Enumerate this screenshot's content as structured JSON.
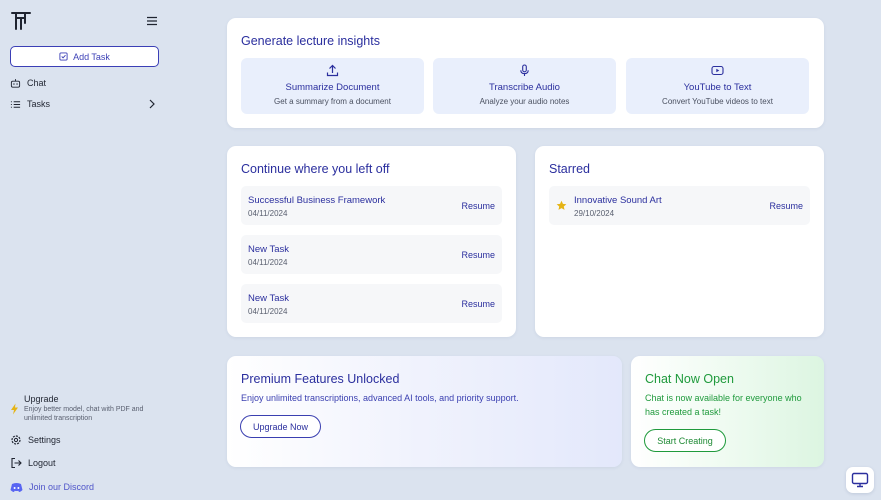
{
  "sidebar": {
    "add_task_label": "Add Task",
    "items": [
      {
        "label": "Chat"
      },
      {
        "label": "Tasks"
      }
    ],
    "upgrade": {
      "title": "Upgrade",
      "desc": "Enjoy better model, chat with PDF and unlimited transcription"
    },
    "settings_label": "Settings",
    "logout_label": "Logout",
    "discord_label": "Join our Discord"
  },
  "insights": {
    "title": "Generate lecture insights",
    "cards": [
      {
        "title": "Summarize Document",
        "sub": "Get a summary from a document",
        "icon": "upload-icon"
      },
      {
        "title": "Transcribe Audio",
        "sub": "Analyze your audio notes",
        "icon": "microphone-icon"
      },
      {
        "title": "YouTube to Text",
        "sub": "Convert YouTube videos to text",
        "icon": "youtube-icon"
      }
    ]
  },
  "continue": {
    "title": "Continue where you left off",
    "rows": [
      {
        "title": "Successful Business Framework",
        "date": "04/11/2024",
        "action": "Resume"
      },
      {
        "title": "New Task",
        "date": "04/11/2024",
        "action": "Resume"
      },
      {
        "title": "New Task",
        "date": "04/11/2024",
        "action": "Resume"
      }
    ]
  },
  "starred": {
    "title": "Starred",
    "rows": [
      {
        "title": "Innovative Sound Art",
        "date": "29/10/2024",
        "action": "Resume"
      }
    ]
  },
  "premium": {
    "title": "Premium Features Unlocked",
    "desc": "Enjoy unlimited transcriptions, advanced AI tools, and priority support.",
    "button": "Upgrade Now"
  },
  "chat_open": {
    "title": "Chat Now Open",
    "desc": "Chat is now available for everyone who has created a task!",
    "button": "Start Creating"
  },
  "colors": {
    "brand": "#2b2f9e",
    "accent_green": "#1f9a3c",
    "star": "#e5b416",
    "background": "#dbe3ef"
  }
}
